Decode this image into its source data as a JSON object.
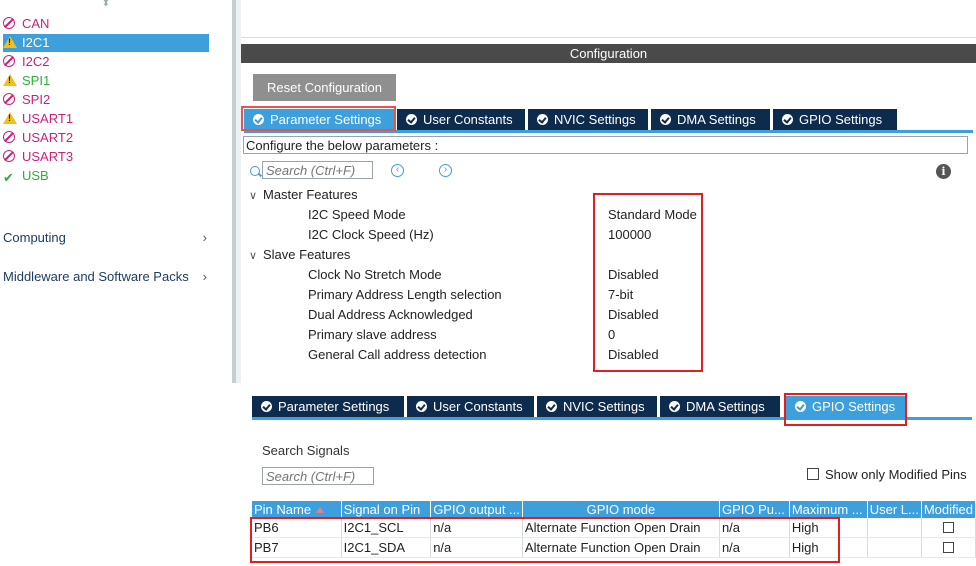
{
  "sidebar": {
    "peripherals": [
      {
        "label": "CAN",
        "status": "disabled",
        "color": "#cc1f78",
        "icon": "ban-icon"
      },
      {
        "label": "I2C1",
        "status": "warning-selected",
        "color": "#ffffff",
        "icon": "warning-icon"
      },
      {
        "label": "I2C2",
        "status": "disabled",
        "color": "#cc1f78",
        "icon": "ban-icon"
      },
      {
        "label": "SPI1",
        "status": "warning",
        "color": "#2fae3c",
        "icon": "warning-icon"
      },
      {
        "label": "SPI2",
        "status": "disabled",
        "color": "#cc1f78",
        "icon": "ban-icon"
      },
      {
        "label": "USART1",
        "status": "warning",
        "color": "#cc1f78",
        "icon": "warning-icon"
      },
      {
        "label": "USART2",
        "status": "disabled",
        "color": "#cc1f78",
        "icon": "ban-icon"
      },
      {
        "label": "USART3",
        "status": "disabled",
        "color": "#cc1f78",
        "icon": "ban-icon"
      },
      {
        "label": "USB",
        "status": "ok",
        "color": "#2fae3c",
        "icon": "check-icon"
      }
    ],
    "categories": [
      {
        "label": "Computing"
      },
      {
        "label": "Middleware and Software Packs"
      }
    ]
  },
  "config": {
    "header": "Configuration",
    "reset_button": "Reset Configuration",
    "tabs": [
      {
        "label": "Parameter Settings",
        "active": true
      },
      {
        "label": "User Constants",
        "active": false
      },
      {
        "label": "NVIC Settings",
        "active": false
      },
      {
        "label": "DMA Settings",
        "active": false
      },
      {
        "label": "GPIO Settings",
        "active": false
      }
    ],
    "description": "Configure the below parameters :",
    "search_placeholder": "Search (Ctrl+F)",
    "groups": [
      {
        "title": "Master Features",
        "params": [
          {
            "name": "I2C Speed Mode",
            "value": "Standard Mode"
          },
          {
            "name": "I2C Clock Speed (Hz)",
            "value": "100000"
          }
        ]
      },
      {
        "title": "Slave Features",
        "params": [
          {
            "name": "Clock No Stretch Mode",
            "value": "Disabled"
          },
          {
            "name": "Primary Address Length selection",
            "value": "7-bit"
          },
          {
            "name": "Dual Address Acknowledged",
            "value": "Disabled"
          },
          {
            "name": "Primary slave address",
            "value": "0"
          },
          {
            "name": "General Call address detection",
            "value": "Disabled"
          }
        ]
      }
    ]
  },
  "gpio": {
    "tabs": [
      {
        "label": "Parameter Settings",
        "active": false
      },
      {
        "label": "User Constants",
        "active": false
      },
      {
        "label": "NVIC Settings",
        "active": false
      },
      {
        "label": "DMA Settings",
        "active": false
      },
      {
        "label": "GPIO Settings",
        "active": true
      }
    ],
    "search_label": "Search Signals",
    "search_placeholder": "Search (Ctrl+F)",
    "only_modified_label": "Show only Modified Pins",
    "columns": [
      "Pin Name",
      "Signal on Pin",
      "GPIO output ...",
      "GPIO mode",
      "GPIO Pu...",
      "Maximum ...",
      "User L...",
      "Modified"
    ],
    "rows": [
      {
        "pin": "PB6",
        "signal": "I2C1_SCL",
        "output": "n/a",
        "mode": "Alternate Function Open Drain",
        "pull": "n/a",
        "max": "High",
        "user": "",
        "modified": false
      },
      {
        "pin": "PB7",
        "signal": "I2C1_SDA",
        "output": "n/a",
        "mode": "Alternate Function Open Drain",
        "pull": "n/a",
        "max": "High",
        "user": "",
        "modified": false
      }
    ]
  },
  "colors": {
    "accent": "#3d9fdc",
    "tab_dark": "#0d2b4c",
    "highlight": "#e02020",
    "header": "#4a4a4a"
  }
}
